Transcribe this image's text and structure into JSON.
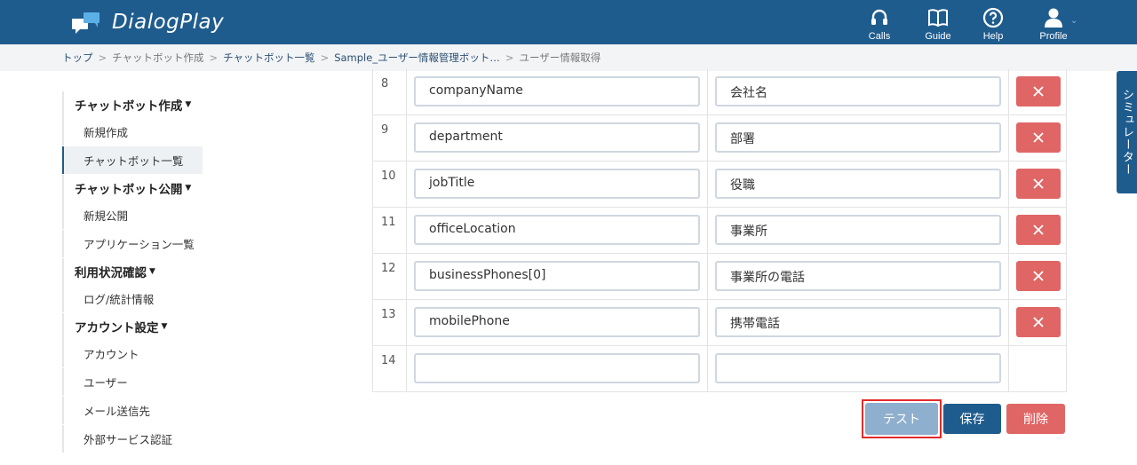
{
  "app": {
    "name": "DialogPlay"
  },
  "nav": [
    {
      "label": "Calls",
      "icon": "headset-icon"
    },
    {
      "label": "Guide",
      "icon": "book-icon"
    },
    {
      "label": "Help",
      "icon": "help-circle-icon"
    },
    {
      "label": "Profile",
      "icon": "user-icon"
    }
  ],
  "breadcrumb": {
    "items": [
      "トップ",
      "チャットボット作成",
      "チャットボット一覧",
      "Sample_ユーザー情報管理ボット…",
      "ユーザー情報取得"
    ],
    "separator": ">"
  },
  "sidebar": {
    "sections": [
      {
        "title": "チャットボット作成",
        "items": [
          "新規作成",
          "チャットボット一覧"
        ]
      },
      {
        "title": "チャットボット公開",
        "items": [
          "新規公開",
          "アプリケーション一覧"
        ]
      },
      {
        "title": "利用状況確認",
        "items": [
          "ログ/統計情報"
        ]
      },
      {
        "title": "アカウント設定",
        "items": [
          "アカウント",
          "ユーザー",
          "メール送信先",
          "外部サービス認証"
        ]
      }
    ],
    "active_item": "チャットボット一覧"
  },
  "table": {
    "rows": [
      {
        "num": "8",
        "key": "companyName",
        "value": "会社名",
        "deletable": true
      },
      {
        "num": "9",
        "key": "department",
        "value": "部署",
        "deletable": true
      },
      {
        "num": "10",
        "key": "jobTitle",
        "value": "役職",
        "deletable": true
      },
      {
        "num": "11",
        "key": "officeLocation",
        "value": "事業所",
        "deletable": true
      },
      {
        "num": "12",
        "key": "businessPhones[0]",
        "value": "事業所の電話",
        "deletable": true
      },
      {
        "num": "13",
        "key": "mobilePhone",
        "value": "携帯電話",
        "deletable": true
      },
      {
        "num": "14",
        "key": "",
        "value": "",
        "deletable": false
      }
    ]
  },
  "actions": {
    "test": "テスト",
    "save": "保存",
    "delete": "削除"
  },
  "simulator_tab": "シミュレーター",
  "colors": {
    "primary": "#1f5c8e",
    "danger": "#e06666",
    "test_button": "#8eafcd",
    "highlight": "#e32b2b"
  }
}
